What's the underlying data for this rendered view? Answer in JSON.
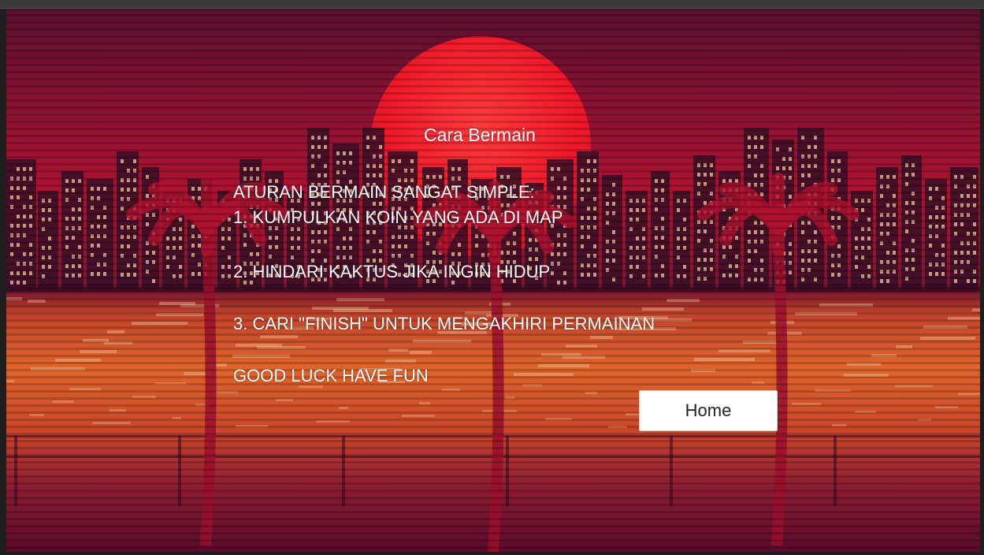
{
  "screen": {
    "title": "Cara Bermain",
    "rules_intro": "ATURAN BERMAIN SANGAT SIMPLE:",
    "rules": [
      "1. KUMPULKAN KOIN YANG ADA DI MAP",
      "2. HINDARI KAKTUS JIKA INGIN HIDUP",
      "3. CARI \"FINISH\" UNTUK MENGAKHIRI PERMAINAN"
    ],
    "closing": "GOOD LUCK HAVE FUN",
    "home_label": "Home"
  },
  "colors": {
    "sky_top": "#5a0f2e",
    "sun": "#f0182a",
    "water": "#e0652a",
    "building": "#3a0f25",
    "window": "#f2c7a0",
    "palm": "#b0122f",
    "text": "#ffffff",
    "button_bg": "#ffffff"
  }
}
